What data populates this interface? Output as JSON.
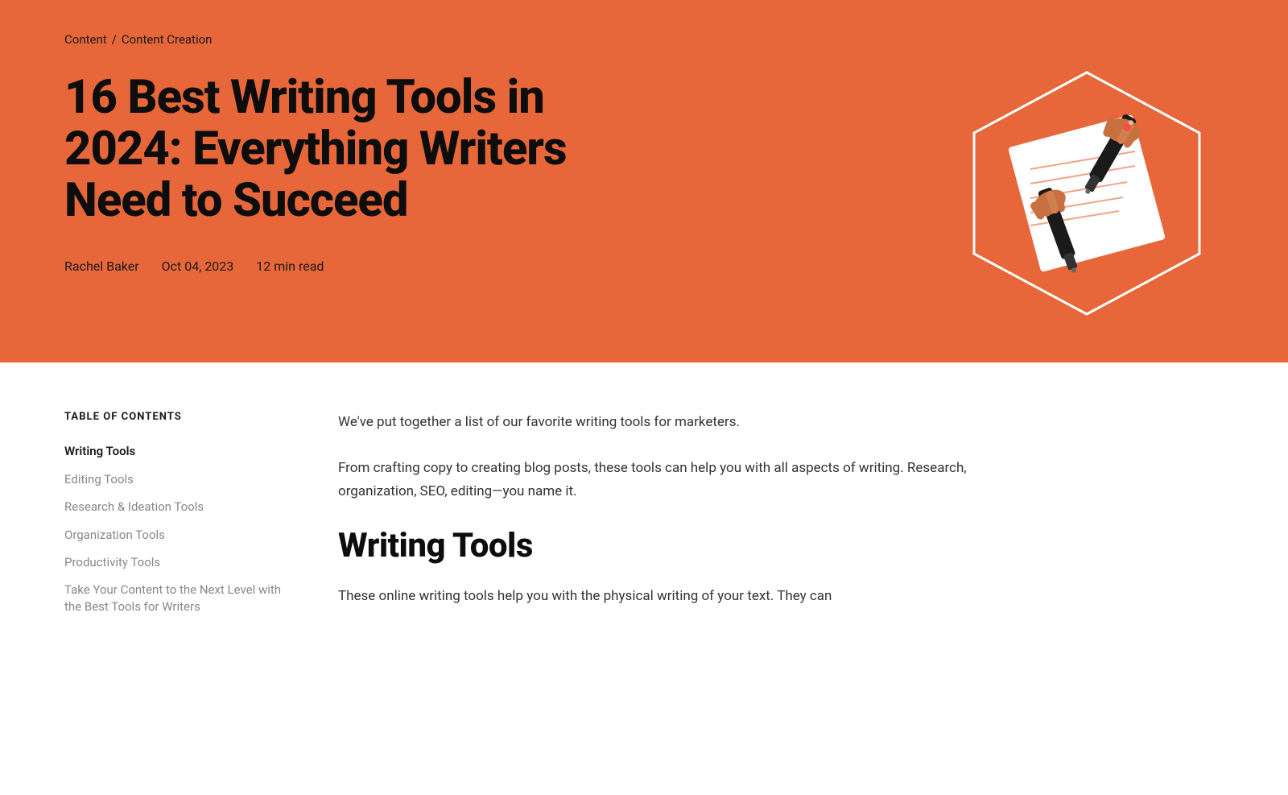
{
  "breadcrumb": {
    "parent": "Content",
    "separator": "/",
    "current": "Content Creation"
  },
  "hero": {
    "title": "16 Best Writing Tools in 2024: Everything Writers Need to Succeed",
    "author": "Rachel Baker",
    "date": "Oct 04, 2023",
    "read_time": "12 min read"
  },
  "toc": {
    "heading": "TABLE OF CONTENTS",
    "items": [
      {
        "label": "Writing Tools",
        "state": "active"
      },
      {
        "label": "Editing Tools",
        "state": "inactive"
      },
      {
        "label": "Research & Ideation Tools",
        "state": "inactive"
      },
      {
        "label": "Organization Tools",
        "state": "inactive"
      },
      {
        "label": "Productivity Tools",
        "state": "inactive"
      },
      {
        "label": "Take Your Content to the Next Level with the Best Tools for Writers",
        "state": "inactive-multiline"
      }
    ]
  },
  "article": {
    "intro_para1": "We've put together a list of our favorite writing tools for marketers.",
    "intro_para2": "From crafting copy to creating blog posts, these tools can help you with all aspects of writing. Research, organization, SEO, editing—you name it.",
    "section1_title": "Writing Tools",
    "section1_text": "These online writing tools help you with the physical writing of your text. They can"
  },
  "colors": {
    "hero_bg": "#e8673a",
    "active_toc": "#1a1a1a",
    "inactive_toc": "#888888"
  }
}
